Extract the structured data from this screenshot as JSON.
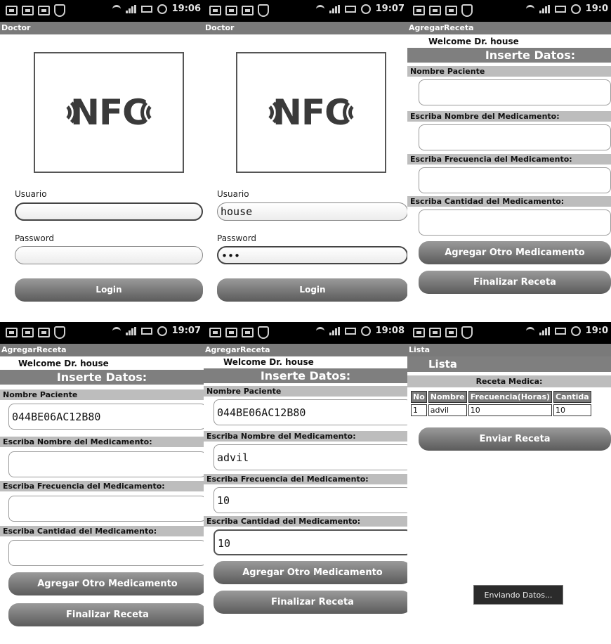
{
  "screens": [
    {
      "status_time": "19:06",
      "title": "Doctor",
      "logo_text": "NFC",
      "usuario_label": "Usuario",
      "usuario_value": "",
      "password_label": "Password",
      "password_value": "",
      "login_label": "Login"
    },
    {
      "status_time": "19:07",
      "title": "Doctor",
      "logo_text": "NFC",
      "usuario_label": "Usuario",
      "usuario_value": "house",
      "password_label": "Password",
      "password_value": "•••",
      "login_label": "Login"
    },
    {
      "status_time": "19:0",
      "title": "AgregarReceta",
      "welcome": "Welcome Dr. house",
      "section": "Inserte Datos:",
      "labels": [
        "Nombre Paciente",
        "Escriba Nombre del Medicamento:",
        "Escriba Frecuencia del Medicamento:",
        "Escriba Cantidad del Medicamento:"
      ],
      "values": [
        "",
        "",
        "",
        ""
      ],
      "btn_agregar": "Agregar Otro Medicamento",
      "btn_finalizar": "Finalizar Receta"
    },
    {
      "status_time": "19:07",
      "title": "AgregarReceta",
      "welcome": "Welcome Dr. house",
      "section": "Inserte Datos:",
      "labels": [
        "Nombre Paciente",
        "Escriba Nombre del Medicamento:",
        "Escriba Frecuencia del Medicamento:",
        "Escriba Cantidad del Medicamento:"
      ],
      "values": [
        "044BE06AC12B80",
        "",
        "",
        ""
      ],
      "btn_agregar": "Agregar Otro Medicamento",
      "btn_finalizar": "Finalizar Receta"
    },
    {
      "status_time": "19:08",
      "title": "AgregarReceta",
      "welcome": "Welcome Dr. house",
      "section": "Inserte Datos:",
      "labels": [
        "Nombre Paciente",
        "Escriba Nombre del Medicamento:",
        "Escriba Frecuencia del Medicamento:",
        "Escriba Cantidad del Medicamento:"
      ],
      "values": [
        "044BE06AC12B80",
        "advil",
        "10",
        "10"
      ],
      "btn_agregar": "Agregar Otro Medicamento",
      "btn_finalizar": "Finalizar Receta"
    },
    {
      "status_time": "19:0",
      "title": "Lista",
      "lista_heading": "Lista",
      "receta_title": "Receta Medica:",
      "table_headers": [
        "No",
        "Nombre",
        "Frecuencia(Horas)",
        "Cantida"
      ],
      "table_rows": [
        [
          "1",
          "advil",
          "10",
          "10"
        ]
      ],
      "btn_enviar": "Enviar Receta",
      "toast": "Enviando Datos..."
    }
  ]
}
